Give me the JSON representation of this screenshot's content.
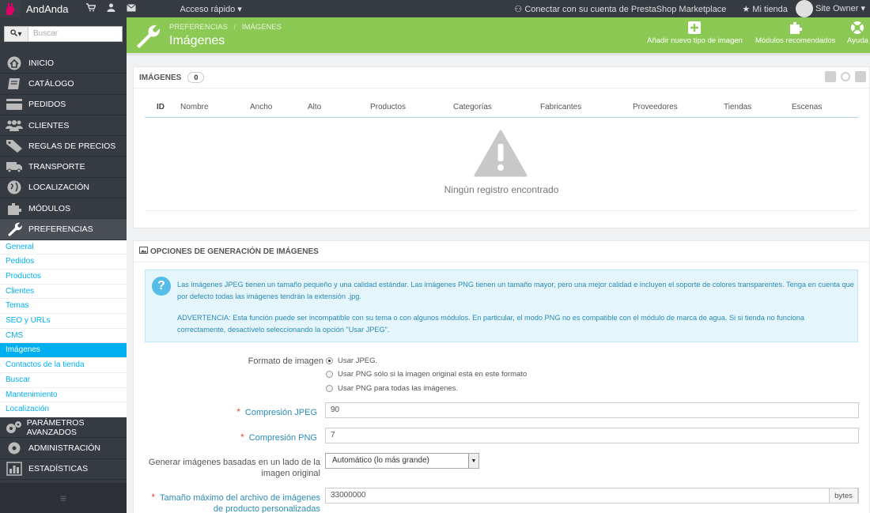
{
  "topbar": {
    "shop_name": "AndAnda",
    "quick_access": "Acceso rápido",
    "connect_marketplace": "Conectar con su cuenta de PrestaShop Marketplace",
    "my_store": "Mi tienda",
    "user": "Site Owner"
  },
  "sidebar": {
    "search_placeholder": "Buscar",
    "menu": [
      {
        "label": "Inicio",
        "icon": "home-icon"
      },
      {
        "label": "Catálogo",
        "icon": "book-icon"
      },
      {
        "label": "Pedidos",
        "icon": "credit-card-icon"
      },
      {
        "label": "Clientes",
        "icon": "users-icon"
      },
      {
        "label": "Reglas de precios",
        "icon": "tag-icon"
      },
      {
        "label": "Transporte",
        "icon": "truck-icon"
      },
      {
        "label": "Localización",
        "icon": "globe-icon"
      },
      {
        "label": "Módulos",
        "icon": "puzzle-icon"
      },
      {
        "label": "Preferencias",
        "icon": "wrench-icon"
      }
    ],
    "submenu": [
      "General",
      "Pedidos",
      "Productos",
      "Clientes",
      "Temas",
      "SEO y URLs",
      "CMS",
      "Imágenes",
      "Contactos de la tienda",
      "Buscar",
      "Mantenimiento",
      "Localización"
    ],
    "active_submenu": "Imágenes",
    "menu_bottom": [
      {
        "label": "Parámetros avanzados",
        "icon": "cogs-icon"
      },
      {
        "label": "Administración",
        "icon": "cog-icon"
      },
      {
        "label": "Estadísticas",
        "icon": "bar-chart-icon"
      }
    ]
  },
  "header": {
    "breadcrumb_1": "Preferencias",
    "breadcrumb_sep": "/",
    "breadcrumb_2": "Imágenes",
    "title": "Imágenes",
    "btn_add": "Añadir nuevo tipo de imagen",
    "btn_modules": "Módulos recomendados",
    "btn_help": "Ayuda"
  },
  "images_panel": {
    "heading": "Imágenes",
    "count": "0",
    "columns": [
      "ID",
      "Nombre",
      "Ancho",
      "Alto",
      "Productos",
      "Categorías",
      "Fabricantes",
      "Proveedores",
      "Tiendas",
      "Escenas"
    ],
    "empty_message": "Ningún registro encontrado"
  },
  "options_panel": {
    "heading": "Opciones de generación de imágenes",
    "alert_p1": "Las imágenes JPEG tienen un tamaño pequeño y una calidad estándar. Las imágenes PNG tienen un tamaño mayor, pero una mejor calidad e incluyen el soporte de colores transparentes. Tenga en cuenta que por defecto todas las imágenes tendrán la extensión .jpg.",
    "alert_p2": "ADVERTENCIA: Esta función puede ser incompatible con su tema o con algunos módulos. En particular, el modo PNG no es compatible con el módulo de marca de agua. Si si tienda no funciona correctamente, desactívelo seleccionando la opción \"Usar JPEG\".",
    "format_label": "Formato de imagen",
    "format_options": [
      "Usar JPEG.",
      "Usar PNG sólo si la imagen original está en este formato",
      "Usar PNG para todas las imágenes."
    ],
    "jpeg_label": "Compresión JPEG",
    "jpeg_value": "90",
    "png_label": "Compresión PNG",
    "png_value": "7",
    "side_label_1": "Generar imágenes basadas en un lado de la",
    "side_label_2": "imagen original",
    "side_value": "Automático (lo más grande)",
    "maxsize_label_1": "Tamaño máximo del archivo de imágenes",
    "maxsize_label_2": "de producto personalizadas",
    "maxsize_value": "33000000",
    "maxsize_unit": "bytes"
  },
  "colors": {
    "header_green": "#8bc954",
    "sidebar_dark": "#363a41",
    "accent_blue": "#00aff0"
  }
}
